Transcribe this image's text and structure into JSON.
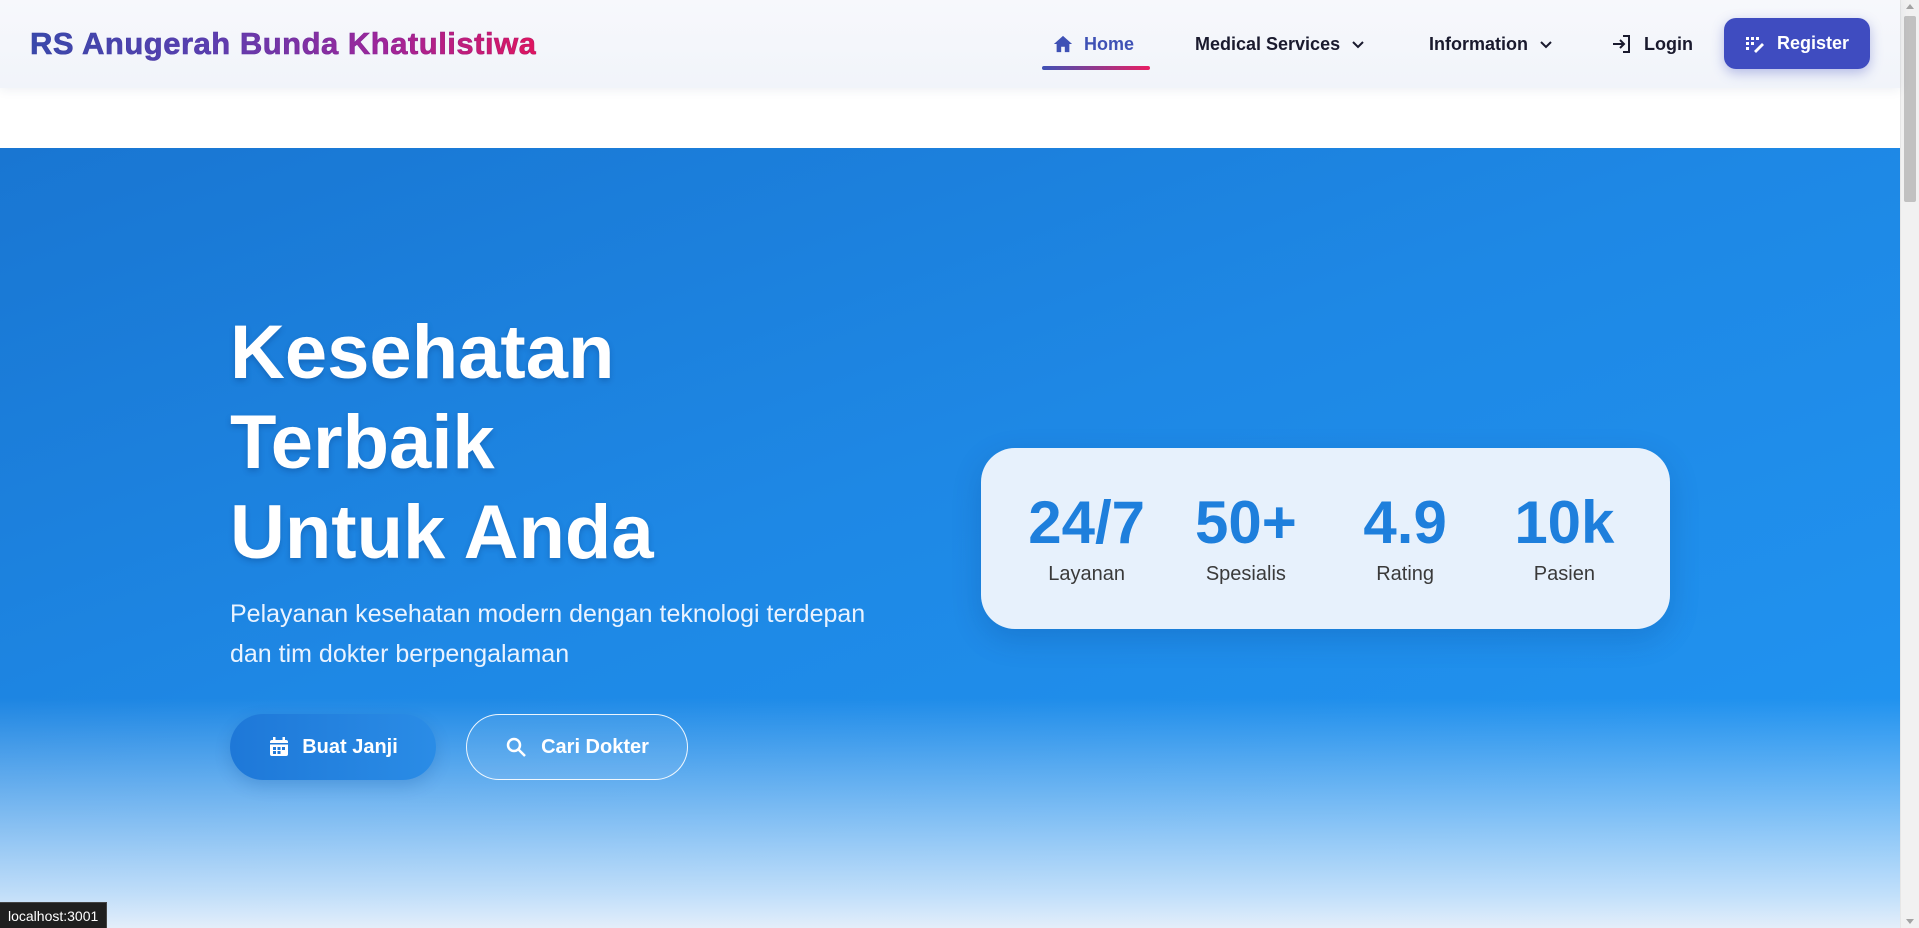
{
  "navbar": {
    "brand": "RS Anugerah Bunda Khatulistiwa",
    "items": [
      {
        "label": "Home",
        "icon": "home-icon"
      },
      {
        "label": "Medical Services",
        "icon": "chevron-down-icon"
      },
      {
        "label": "Information",
        "icon": "chevron-down-icon"
      },
      {
        "label": "Login",
        "icon": "login-icon"
      }
    ],
    "register_label": "Register",
    "active_color": "#3f51b5",
    "register_color": "#3f4cc0"
  },
  "hero": {
    "title_lines": [
      "Kesehatan",
      "Terbaik",
      "Untuk Anda"
    ],
    "subtitle": "Pelayanan kesehatan modern dengan teknologi terdepan dan tim dokter berpengalaman",
    "primary_button": "Buat Janji",
    "secondary_button": "Cari Dokter",
    "background_color": "#1e88e5"
  },
  "stats": [
    {
      "value": "24/7",
      "label": "Layanan"
    },
    {
      "value": "50+",
      "label": "Spesialis"
    },
    {
      "value": "4.9",
      "label": "Rating"
    },
    {
      "value": "10k",
      "label": "Pasien"
    }
  ],
  "status_bar": {
    "url": "localhost:3001"
  }
}
